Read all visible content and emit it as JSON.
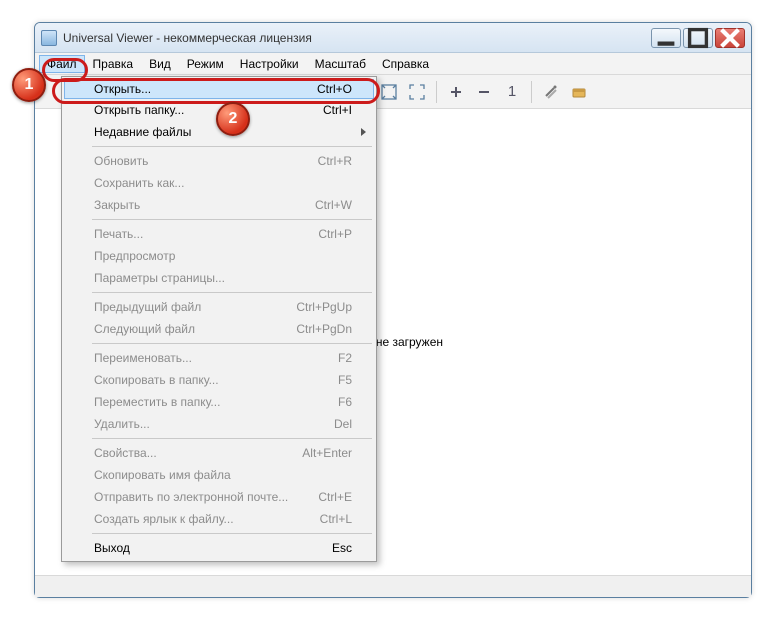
{
  "titlebar": {
    "text": "Universal Viewer - некоммерческая лицензия"
  },
  "menubar": [
    "Файл",
    "Правка",
    "Вид",
    "Режим",
    "Настройки",
    "Масштаб",
    "Справка"
  ],
  "toolbar": {
    "zoom_number": "1"
  },
  "content": {
    "message": "Файл не загружен"
  },
  "menu": {
    "groups": [
      [
        {
          "label": "Открыть...",
          "shortcut": "Ctrl+O",
          "highlight": true
        },
        {
          "label": "Открыть папку...",
          "shortcut": "Ctrl+I"
        },
        {
          "label": "Недавние файлы",
          "submenu": true
        }
      ],
      [
        {
          "label": "Обновить",
          "shortcut": "Ctrl+R",
          "disabled": true
        },
        {
          "label": "Сохранить как...",
          "disabled": true
        },
        {
          "label": "Закрыть",
          "shortcut": "Ctrl+W",
          "disabled": true
        }
      ],
      [
        {
          "label": "Печать...",
          "shortcut": "Ctrl+P",
          "disabled": true
        },
        {
          "label": "Предпросмотр",
          "disabled": true
        },
        {
          "label": "Параметры страницы...",
          "disabled": true
        }
      ],
      [
        {
          "label": "Предыдущий файл",
          "shortcut": "Ctrl+PgUp",
          "disabled": true
        },
        {
          "label": "Следующий файл",
          "shortcut": "Ctrl+PgDn",
          "disabled": true
        }
      ],
      [
        {
          "label": "Переименовать...",
          "shortcut": "F2",
          "disabled": true
        },
        {
          "label": "Скопировать в папку...",
          "shortcut": "F5",
          "disabled": true
        },
        {
          "label": "Переместить в папку...",
          "shortcut": "F6",
          "disabled": true
        },
        {
          "label": "Удалить...",
          "shortcut": "Del",
          "disabled": true
        }
      ],
      [
        {
          "label": "Свойства...",
          "shortcut": "Alt+Enter",
          "disabled": true
        },
        {
          "label": "Скопировать имя файла",
          "disabled": true
        },
        {
          "label": "Отправить по электронной почте...",
          "shortcut": "Ctrl+E",
          "disabled": true
        },
        {
          "label": "Создать ярлык к файлу...",
          "shortcut": "Ctrl+L",
          "disabled": true
        }
      ],
      [
        {
          "label": "Выход",
          "shortcut": "Esc"
        }
      ]
    ]
  },
  "steps": {
    "one": "1",
    "two": "2"
  }
}
